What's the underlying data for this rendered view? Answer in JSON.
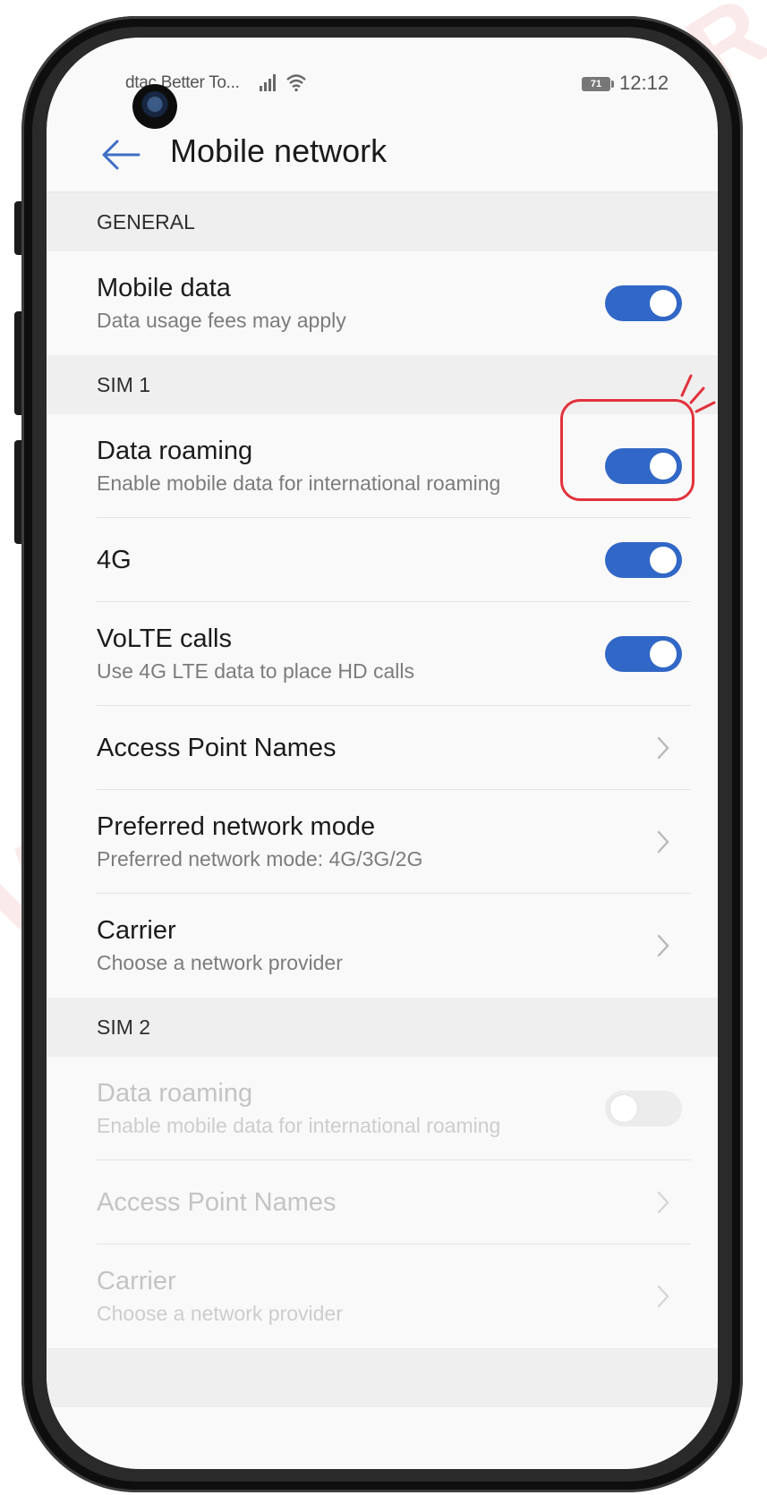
{
  "watermark": {
    "top": "SAMURAI",
    "left": "WM"
  },
  "status_bar": {
    "carrier": "dtac Better To...",
    "signal_icons": " ▌▃▅ ≡",
    "battery_level": "71",
    "time": "12:12"
  },
  "header": {
    "title": "Mobile network"
  },
  "sections": {
    "general": {
      "label": "GENERAL",
      "mobile_data": {
        "title": "Mobile data",
        "subtitle": "Data usage fees may apply",
        "state": "on"
      }
    },
    "sim1": {
      "label": "SIM 1",
      "data_roaming": {
        "title": "Data roaming",
        "subtitle": "Enable mobile data for international roaming",
        "state": "on"
      },
      "lte": {
        "title": "4G",
        "state": "on"
      },
      "volte": {
        "title": "VoLTE calls",
        "subtitle": "Use 4G LTE data to place HD calls",
        "state": "on"
      },
      "apn": {
        "title": "Access Point Names"
      },
      "network_mode": {
        "title": "Preferred network mode",
        "subtitle": "Preferred network mode: 4G/3G/2G"
      },
      "carrier": {
        "title": "Carrier",
        "subtitle": "Choose a network provider"
      }
    },
    "sim2": {
      "label": "SIM 2",
      "data_roaming": {
        "title": "Data roaming",
        "subtitle": "Enable mobile data for international roaming",
        "state": "off"
      },
      "apn": {
        "title": "Access Point Names"
      },
      "carrier": {
        "title": "Carrier",
        "subtitle": "Choose a network provider"
      }
    }
  },
  "colors": {
    "accent": "#3167c6",
    "highlight": "#e2323c"
  },
  "icons": {
    "back": "arrow-left-icon",
    "chevron": "chevron-right-icon",
    "signal": "signal-icon",
    "wifi": "wifi-icon",
    "battery": "battery-icon"
  }
}
